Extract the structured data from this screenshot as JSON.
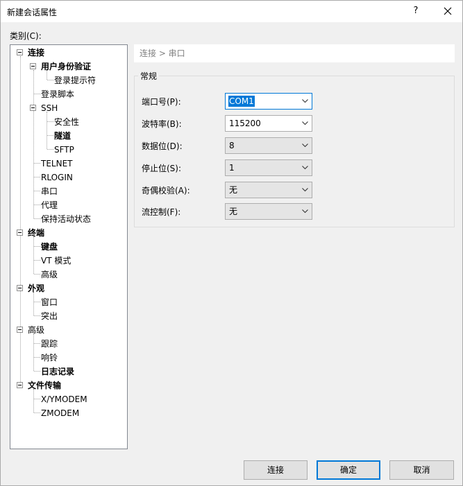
{
  "window": {
    "title": "新建会话属性",
    "help_label": "?"
  },
  "category_label": "类别(C):",
  "tree": [
    {
      "label": "连接",
      "bold": true
    },
    {
      "label": "用户身份验证",
      "bold": true
    },
    {
      "label": "登录提示符",
      "bold": false
    },
    {
      "label": "登录脚本",
      "bold": false
    },
    {
      "label": "SSH",
      "bold": false
    },
    {
      "label": "安全性",
      "bold": false
    },
    {
      "label": "隧道",
      "bold": true
    },
    {
      "label": "SFTP",
      "bold": false
    },
    {
      "label": "TELNET",
      "bold": false
    },
    {
      "label": "RLOGIN",
      "bold": false
    },
    {
      "label": "串口",
      "bold": false
    },
    {
      "label": "代理",
      "bold": false
    },
    {
      "label": "保持活动状态",
      "bold": false
    },
    {
      "label": "终端",
      "bold": true
    },
    {
      "label": "键盘",
      "bold": true
    },
    {
      "label": "VT 模式",
      "bold": false
    },
    {
      "label": "高级",
      "bold": false
    },
    {
      "label": "外观",
      "bold": true
    },
    {
      "label": "窗口",
      "bold": false
    },
    {
      "label": "突出",
      "bold": false
    },
    {
      "label": "高级",
      "bold": false
    },
    {
      "label": "跟踪",
      "bold": false
    },
    {
      "label": "响铃",
      "bold": false
    },
    {
      "label": "日志记录",
      "bold": true
    },
    {
      "label": "文件传输",
      "bold": true
    },
    {
      "label": "X/YMODEM",
      "bold": false
    },
    {
      "label": "ZMODEM",
      "bold": false
    }
  ],
  "breadcrumb": "连接 > 串口",
  "group_title": "常规",
  "fields": {
    "port": {
      "label": "端口号(P):",
      "value": "COM1"
    },
    "baud": {
      "label": "波特率(B):",
      "value": "115200"
    },
    "data_bits": {
      "label": "数据位(D):",
      "value": "8"
    },
    "stop_bits": {
      "label": "停止位(S):",
      "value": "1"
    },
    "parity": {
      "label": "奇偶校验(A):",
      "value": "无"
    },
    "flow": {
      "label": "流控制(F):",
      "value": "无"
    }
  },
  "buttons": {
    "connect": "连接",
    "ok": "确定",
    "cancel": "取消"
  },
  "colors": {
    "accent": "#0078d7",
    "breadcrumb_text": "#808080"
  }
}
